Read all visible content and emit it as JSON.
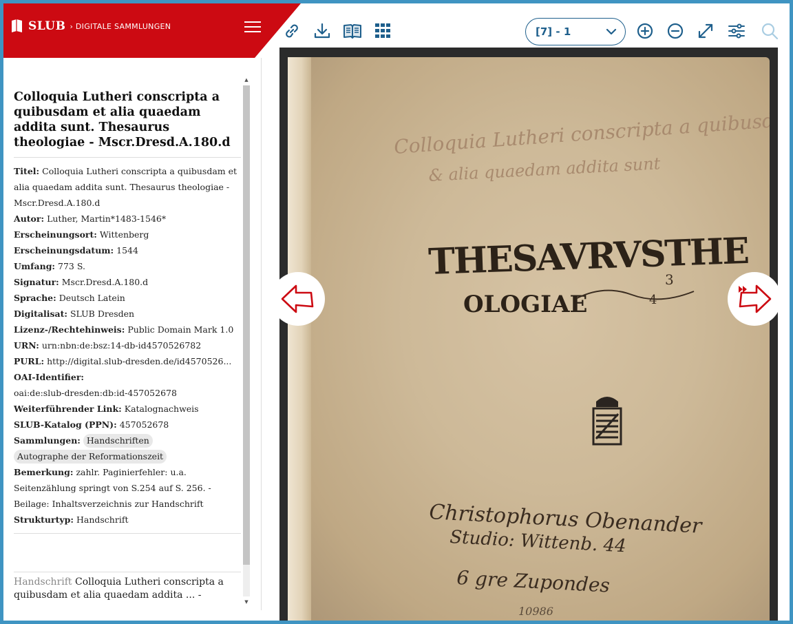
{
  "brand": {
    "logo": "SLUB",
    "separator": "›",
    "subtitle": "DIGITALE SAMMLUNGEN",
    "color": "#cc0a12",
    "icon": "book-icon"
  },
  "toolbar": {
    "icons": [
      "link-icon",
      "download-icon",
      "book-view-icon",
      "grid-icon",
      "zoom-in-icon",
      "zoom-out-icon",
      "fullscreen-icon",
      "settings-sliders-icon",
      "search-icon"
    ],
    "page_select": "[7] - 1",
    "accent": "#1e5f8c"
  },
  "document": {
    "title": "Colloquia Lutheri conscripta a quibusdam et alia quaedam addita sunt. Thesaurus theologiae - Mscr.Dresd.A.180.d"
  },
  "metadata": [
    {
      "label": "Titel:",
      "value": "Colloquia Lutheri conscripta a quibusdam et alia quaedam addita sunt. Thesaurus theologiae - Mscr.Dresd.A.180.d"
    },
    {
      "label": "Autor:",
      "value": "Luther, Martin*1483-1546*"
    },
    {
      "label": "Erscheinungsort:",
      "value": "Wittenberg"
    },
    {
      "label": "Erscheinungsdatum:",
      "value": "1544"
    },
    {
      "label": "Umfang:",
      "value": "773 S."
    },
    {
      "label": "Signatur:",
      "value": "Mscr.Dresd.A.180.d"
    },
    {
      "label": "Sprache:",
      "value": "Deutsch Latein"
    },
    {
      "label": "Digitalisat:",
      "value": "SLUB Dresden"
    },
    {
      "label": "Lizenz-/Rechtehinweis:",
      "value": "Public Domain Mark 1.0"
    },
    {
      "label": "URN:",
      "value": "urn:nbn:de:bsz:14-db-id4570526782"
    },
    {
      "label": "PURL:",
      "value": "http://digital.slub-dresden.de/id4570526..."
    },
    {
      "label": "OAI-Identifier:",
      "value": "oai:de:slub-dresden:db:id-457052678"
    },
    {
      "label": "Weiterführender Link:",
      "value": "Katalognachweis"
    },
    {
      "label": "SLUB-Katalog (PPN):",
      "value": "457052678"
    }
  ],
  "collections": {
    "label": "Sammlungen:",
    "tags": [
      "Handschriften",
      "Autographe der Reformationszeit"
    ]
  },
  "remark": {
    "label": "Bemerkung:",
    "value": "zahlr. Paginierfehler: u.a. Seitenzählung springt von S.254 auf S. 256. - Beilage: Inhaltsverzeichnis zur Handschrift"
  },
  "structure": {
    "label": "Strukturtyp:",
    "value": "Handschrift"
  },
  "breadcrumb": {
    "type": "Handschrift",
    "title": "Colloquia Lutheri conscripta a quibusdam et alia quaedam addita ... -"
  },
  "manuscript": {
    "line1": "Colloquia Lutheri conscripta a quibusdā",
    "line2": "& alia quaedam addita sunt",
    "heading1": "THESAVRVSTHE",
    "heading2": "OLOGIAE",
    "sig1": "Christophorus Obenander",
    "sig2": "Studio: Wittenb. 44",
    "sig3": "6 gre Zupondes",
    "shelf": "10986"
  },
  "navigation": {
    "prev": "arrow-left-icon",
    "next": "fast-forward-arrow-icon"
  }
}
